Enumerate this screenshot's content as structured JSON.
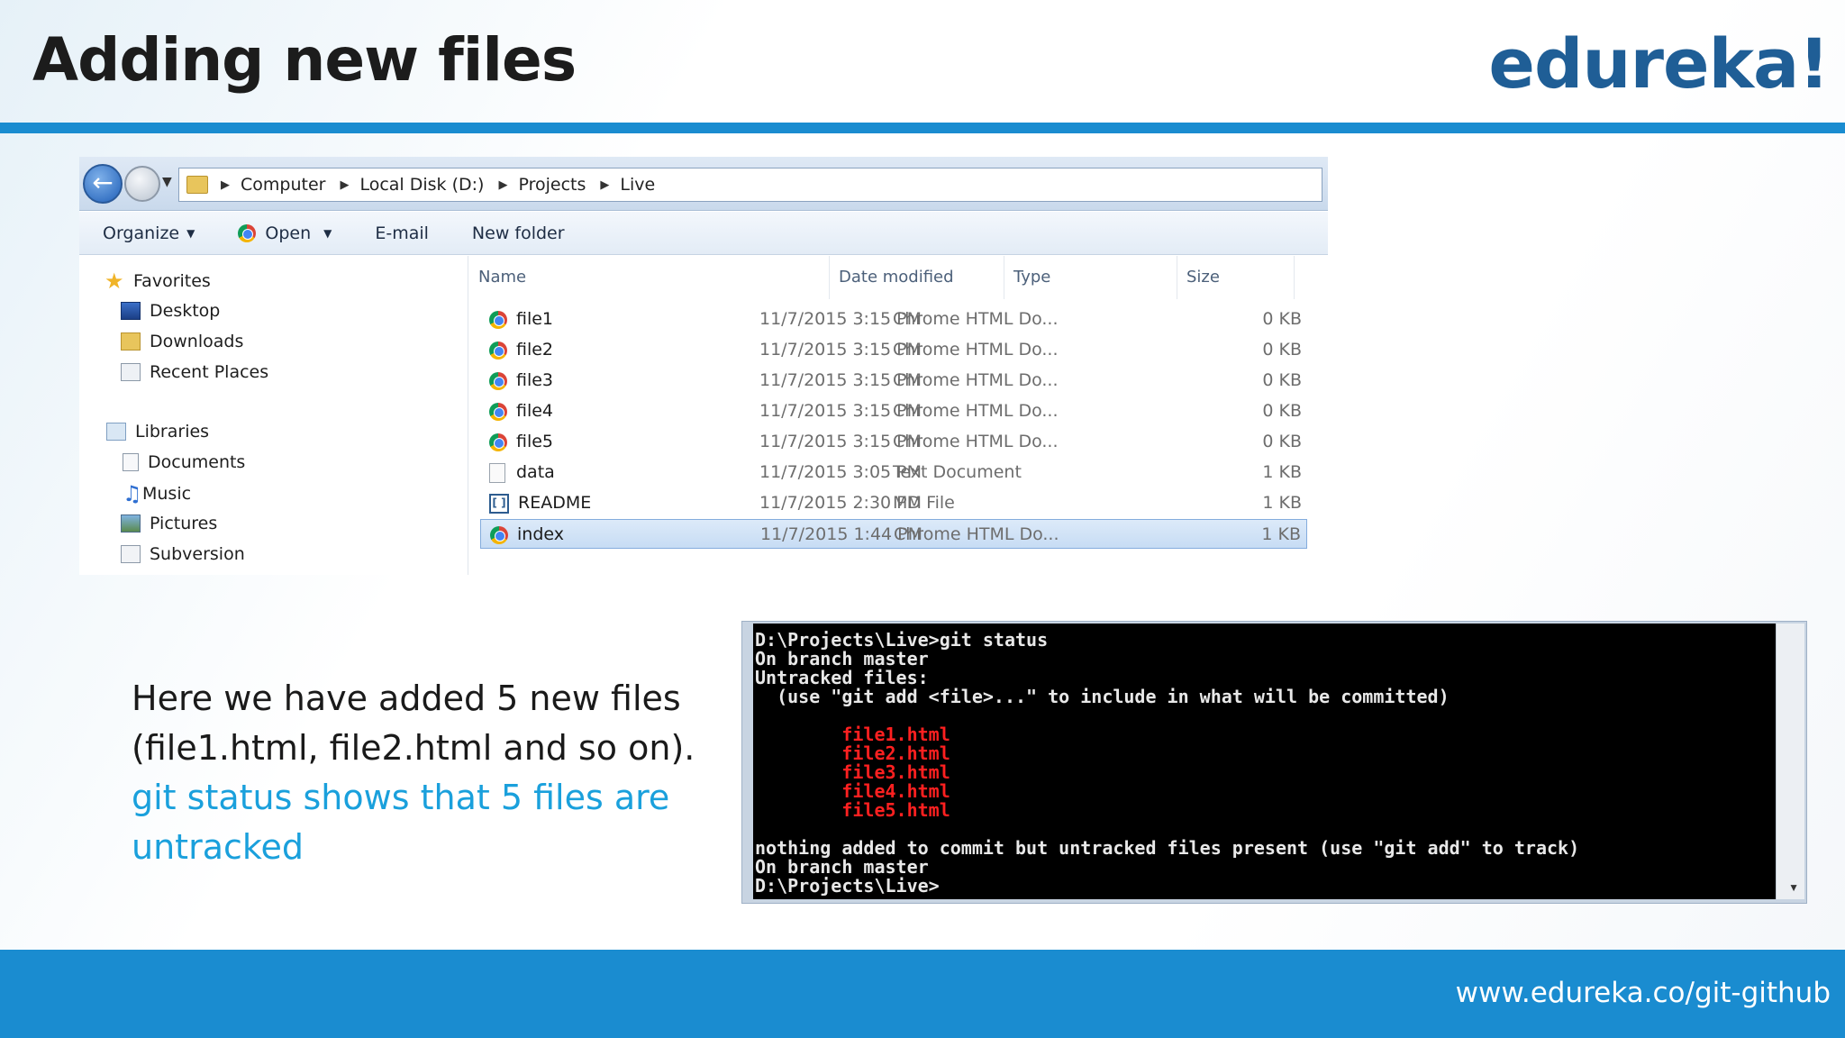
{
  "slide": {
    "title": "Adding new files",
    "logo": "edureka!",
    "footer_url": "www.edureka.co/git-github"
  },
  "explorer": {
    "breadcrumbs": [
      "Computer",
      "Local Disk (D:)",
      "Projects",
      "Live"
    ],
    "toolbar": {
      "organize": "Organize",
      "open": "Open",
      "email": "E-mail",
      "new_folder": "New folder"
    },
    "nav": {
      "favorites": "Favorites",
      "desktop": "Desktop",
      "downloads": "Downloads",
      "recent_places": "Recent Places",
      "libraries": "Libraries",
      "documents": "Documents",
      "music": "Music",
      "pictures": "Pictures",
      "subversion": "Subversion"
    },
    "columns": {
      "name": "Name",
      "date_modified": "Date modified",
      "type": "Type",
      "size": "Size"
    },
    "files": [
      {
        "name": "file1",
        "date": "11/7/2015 3:15 PM",
        "type": "Chrome HTML Do...",
        "size": "0 KB",
        "icon": "chrome-icon"
      },
      {
        "name": "file2",
        "date": "11/7/2015 3:15 PM",
        "type": "Chrome HTML Do...",
        "size": "0 KB",
        "icon": "chrome-icon"
      },
      {
        "name": "file3",
        "date": "11/7/2015 3:15 PM",
        "type": "Chrome HTML Do...",
        "size": "0 KB",
        "icon": "chrome-icon"
      },
      {
        "name": "file4",
        "date": "11/7/2015 3:15 PM",
        "type": "Chrome HTML Do...",
        "size": "0 KB",
        "icon": "chrome-icon"
      },
      {
        "name": "file5",
        "date": "11/7/2015 3:15 PM",
        "type": "Chrome HTML Do...",
        "size": "0 KB",
        "icon": "chrome-icon"
      },
      {
        "name": "data",
        "date": "11/7/2015 3:05 PM",
        "type": "Text Document",
        "size": "1 KB",
        "icon": "text-file-icon"
      },
      {
        "name": "README",
        "date": "11/7/2015 2:30 PM",
        "type": "MD File",
        "size": "1 KB",
        "icon": "md-file-icon"
      },
      {
        "name": "index",
        "date": "11/7/2015 1:44 PM",
        "type": "Chrome HTML Do...",
        "size": "1 KB",
        "icon": "chrome-icon",
        "selected": true
      }
    ]
  },
  "description": {
    "line1": "Here we have added 5 new files (file1.html, file2.html and so on).",
    "line2": "git status shows that 5 files are untracked"
  },
  "console": {
    "lines_before": [
      "D:\\Projects\\Live>git status",
      "On branch master",
      "Untracked files:",
      "  (use \"git add <file>...\" to include in what will be committed)",
      ""
    ],
    "untracked": [
      "        file1.html",
      "        file2.html",
      "        file3.html",
      "        file4.html",
      "        file5.html"
    ],
    "lines_after": [
      "",
      "nothing added to commit but untracked files present (use \"git add\" to track)",
      "On branch master",
      "D:\\Projects\\Live>"
    ]
  }
}
